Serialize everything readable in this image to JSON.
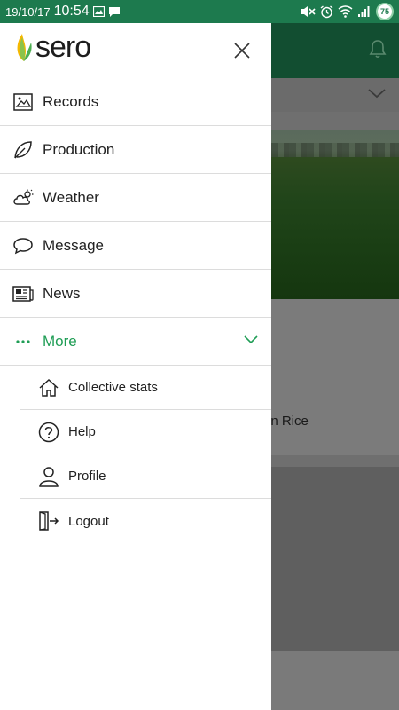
{
  "status_bar": {
    "date": "19/10/17",
    "time": "10:54",
    "battery": "75",
    "icons": [
      "image-icon",
      "chat-icon",
      "mute-icon",
      "alarm-icon",
      "wifi-icon",
      "signal-icon",
      "battery-icon"
    ]
  },
  "drawer": {
    "logo_text": "sero",
    "menu": [
      {
        "label": "Records",
        "icon": "image-icon"
      },
      {
        "label": "Production",
        "icon": "leaf-icon"
      },
      {
        "label": "Weather",
        "icon": "weather-icon"
      },
      {
        "label": "Message",
        "icon": "message-icon"
      },
      {
        "label": "News",
        "icon": "news-icon"
      }
    ],
    "more": {
      "label": "More",
      "icon": "more-dots-icon"
    },
    "submenu": [
      {
        "label": "Collective stats",
        "icon": "home-icon"
      },
      {
        "label": "Help",
        "icon": "help-icon"
      },
      {
        "label": "Profile",
        "icon": "user-icon"
      },
      {
        "label": "Logout",
        "icon": "logout-icon"
      }
    ]
  },
  "background": {
    "card_text": "ern Rice"
  },
  "colors": {
    "status_bar": "#1d7a4e",
    "accent": "#1f9d55",
    "header_dimmed": "#124e31"
  }
}
